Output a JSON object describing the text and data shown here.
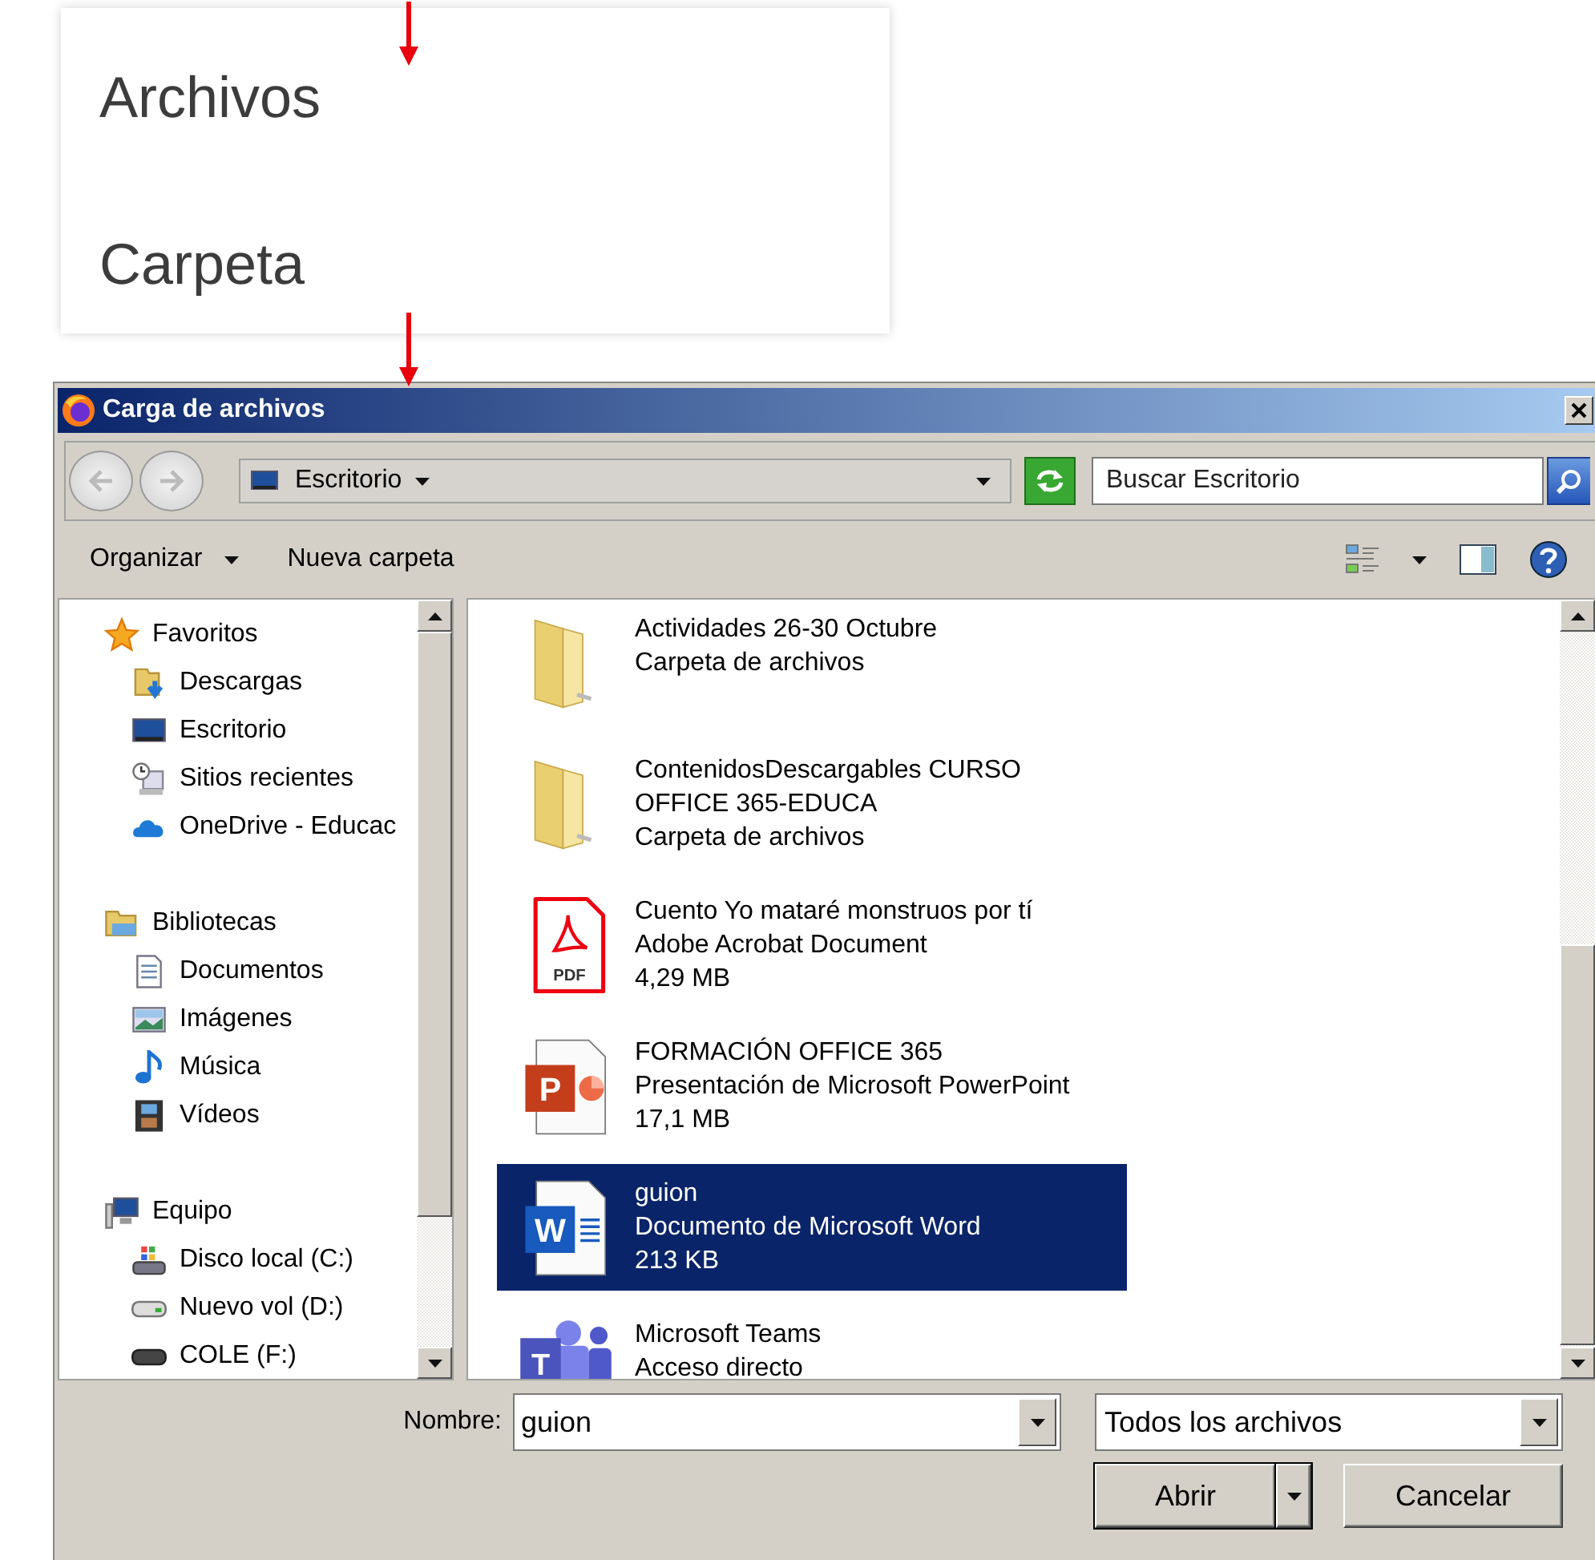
{
  "menu": {
    "items": [
      {
        "label": "Archivos"
      },
      {
        "label": "Carpeta"
      }
    ]
  },
  "dialog": {
    "title": "Carga de archivos",
    "address": {
      "location": "Escritorio"
    },
    "search": {
      "placeholder": "Buscar Escritorio"
    },
    "toolbar": {
      "organize": "Organizar",
      "new_folder": "Nueva carpeta"
    },
    "nav": {
      "groups": [
        {
          "label": "Favoritos",
          "kind": "star",
          "children": [
            {
              "label": "Descargas",
              "kind": "downloads"
            },
            {
              "label": "Escritorio",
              "kind": "desktop"
            },
            {
              "label": "Sitios recientes",
              "kind": "recent"
            },
            {
              "label": "OneDrive - Educac",
              "kind": "cloud"
            }
          ]
        },
        {
          "label": "Bibliotecas",
          "kind": "libraries",
          "children": [
            {
              "label": "Documentos",
              "kind": "documents"
            },
            {
              "label": "Imágenes",
              "kind": "pictures"
            },
            {
              "label": "Música",
              "kind": "music"
            },
            {
              "label": "Vídeos",
              "kind": "videos"
            }
          ]
        },
        {
          "label": "Equipo",
          "kind": "computer",
          "children": [
            {
              "label": "Disco local (C:)",
              "kind": "system-drive"
            },
            {
              "label": "Nuevo vol (D:)",
              "kind": "drive"
            },
            {
              "label": "COLE (F:)",
              "kind": "usb-drive"
            }
          ]
        }
      ]
    },
    "files": [
      {
        "kind": "folder",
        "lines": [
          "Actividades 26-30 Octubre",
          "Carpeta de archivos"
        ],
        "selected": false
      },
      {
        "kind": "folder",
        "lines": [
          "ContenidosDescargables CURSO OFFICE 365-EDUCA",
          "Carpeta de archivos"
        ],
        "selected": false
      },
      {
        "kind": "pdf",
        "icon_text": "PDF",
        "lines": [
          "Cuento Yo mataré monstruos por tí",
          "Adobe Acrobat Document",
          "4,29 MB"
        ],
        "selected": false
      },
      {
        "kind": "presentation",
        "icon_text": "P",
        "lines": [
          "FORMACIÓN OFFICE 365",
          "Presentación de Microsoft PowerPoint",
          "17,1 MB"
        ],
        "selected": false
      },
      {
        "kind": "word",
        "icon_text": "W",
        "lines": [
          "guion",
          "Documento de Microsoft Word",
          "213 KB"
        ],
        "selected": true
      },
      {
        "kind": "teams",
        "icon_text": "T",
        "lines": [
          "Microsoft Teams",
          "Acceso directo"
        ],
        "selected": false
      }
    ],
    "filename": {
      "label": "Nombre:",
      "value": "guion"
    },
    "filter": {
      "value": "Todos los archivos"
    },
    "buttons": {
      "open": "Abrir",
      "cancel": "Cancelar"
    }
  }
}
